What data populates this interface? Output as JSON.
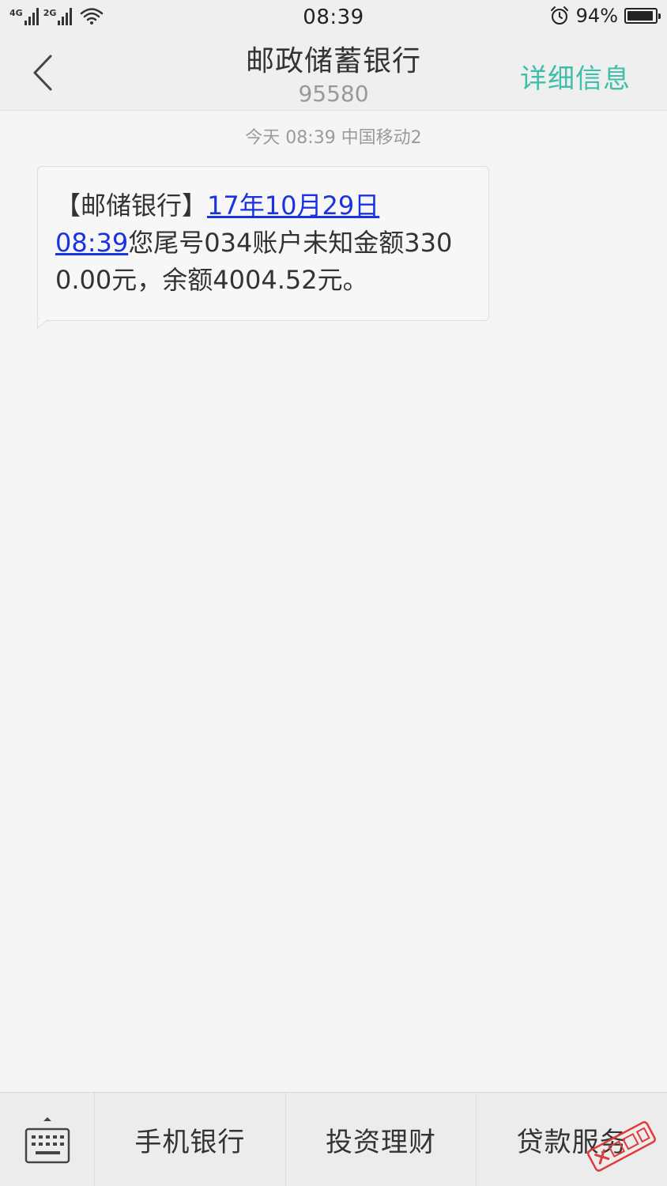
{
  "status_bar": {
    "network1": "4G",
    "network2": "2G",
    "time": "08:39",
    "battery_percent": "94%",
    "battery_level": 0.94
  },
  "header": {
    "title": "邮政储蓄银行",
    "subtitle": "95580",
    "detail_label": "详细信息"
  },
  "conversation": {
    "meta": "今天  08:39  中国移动2",
    "message": {
      "prefix": "【邮储银行】",
      "link_date": "17年10月29日",
      "link_time": "08:39",
      "body": "您尾号034账户未知金额3300.00元，余额4004.52元。"
    }
  },
  "bottom_menu": {
    "items": [
      {
        "label": "手机银行"
      },
      {
        "label": "投资理财"
      },
      {
        "label": "贷款服务"
      }
    ]
  },
  "colors": {
    "accent": "#3fbfa9",
    "link": "#1a33e0",
    "watermark": "#e03a3a"
  }
}
